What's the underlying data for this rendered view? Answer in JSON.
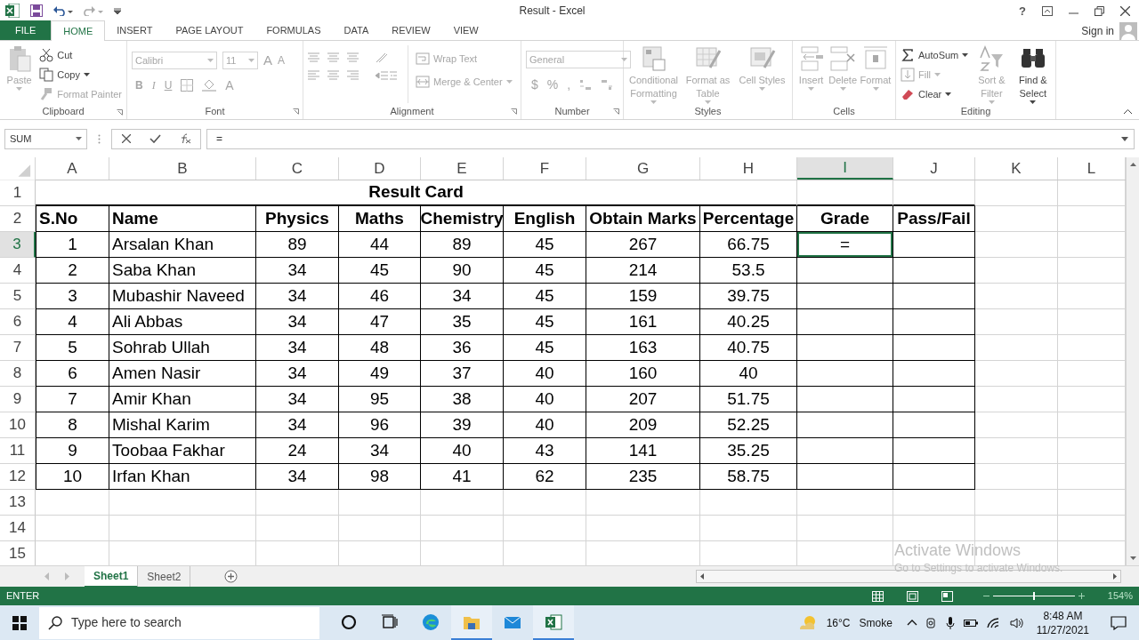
{
  "title_bar": {
    "title": "Result - Excel",
    "help": "?"
  },
  "ribbon": {
    "tabs": [
      {
        "label": "FILE",
        "kind": "file",
        "selected": false
      },
      {
        "label": "HOME",
        "kind": "tab",
        "selected": true
      },
      {
        "label": "INSERT",
        "kind": "tab",
        "selected": false
      },
      {
        "label": "PAGE LAYOUT",
        "kind": "tab",
        "selected": false
      },
      {
        "label": "FORMULAS",
        "kind": "tab",
        "selected": false
      },
      {
        "label": "DATA",
        "kind": "tab",
        "selected": false
      },
      {
        "label": "REVIEW",
        "kind": "tab",
        "selected": false
      },
      {
        "label": "VIEW",
        "kind": "tab",
        "selected": false
      }
    ],
    "sign_in": "Sign in",
    "groups": [
      {
        "label": "Clipboard",
        "kind": "clipboard",
        "large": {
          "label": "Paste",
          "disabled": true,
          "menu": true
        },
        "items": [
          {
            "label": "Cut",
            "disabled": false,
            "menu": false
          },
          {
            "label": "Copy",
            "disabled": false,
            "menu": true
          },
          {
            "label": "Format Painter",
            "disabled": true,
            "menu": false
          }
        ]
      },
      {
        "label": "Font",
        "kind": "font",
        "font_name": "Calibri",
        "font_size": "11",
        "glyphs": [
          "A",
          "A",
          "B",
          "I",
          "U",
          "A"
        ]
      },
      {
        "label": "Alignment",
        "kind": "alignment",
        "items": [
          {
            "label": "Wrap Text",
            "disabled": true,
            "menu": false
          },
          {
            "label": "Merge & Center",
            "disabled": true,
            "menu": true
          }
        ]
      },
      {
        "label": "Number",
        "kind": "number",
        "format": "General",
        "glyphs": [
          "$",
          "%",
          ","
        ]
      },
      {
        "label": "Styles",
        "kind": "large",
        "items": [
          {
            "label": "Conditional Formatting",
            "disabled": true,
            "menu": true
          },
          {
            "label": "Format as Table",
            "disabled": true,
            "menu": true
          },
          {
            "label": "Cell Styles",
            "disabled": true,
            "menu": true
          }
        ]
      },
      {
        "label": "Cells",
        "kind": "large",
        "items": [
          {
            "label": "Insert",
            "disabled": true,
            "menu": true
          },
          {
            "label": "Delete",
            "disabled": true,
            "menu": true
          },
          {
            "label": "Format",
            "disabled": true,
            "menu": true
          }
        ]
      },
      {
        "label": "Editing",
        "kind": "editing",
        "items": [
          {
            "label": "AutoSum",
            "disabled": false,
            "menu": true
          },
          {
            "label": "Fill",
            "disabled": true,
            "menu": true
          },
          {
            "label": "Clear",
            "disabled": false,
            "menu": true
          }
        ],
        "large": [
          {
            "label": "Sort & Filter",
            "disabled": true,
            "menu": true
          },
          {
            "label": "Find & Select",
            "disabled": false,
            "menu": true
          }
        ]
      }
    ]
  },
  "formula_bar": {
    "name_box": "SUM",
    "formula": "="
  },
  "sheet": {
    "columns": [
      {
        "label": "A",
        "selected": false
      },
      {
        "label": "B",
        "selected": false
      },
      {
        "label": "C",
        "selected": false
      },
      {
        "label": "D",
        "selected": false
      },
      {
        "label": "E",
        "selected": false
      },
      {
        "label": "F",
        "selected": false
      },
      {
        "label": "G",
        "selected": false
      },
      {
        "label": "H",
        "selected": false
      },
      {
        "label": "I",
        "selected": true
      },
      {
        "label": "J",
        "selected": false
      },
      {
        "label": "K",
        "selected": false
      },
      {
        "label": "L",
        "selected": false
      }
    ],
    "rows": [
      {
        "number": "1",
        "kind": "title",
        "selected": false,
        "cells": [
          "Result Card"
        ]
      },
      {
        "number": "2",
        "kind": "header",
        "selected": false,
        "cells": [
          "S.No",
          "Name",
          "Physics",
          "Maths",
          "Chemistry",
          "English",
          "Obtain Marks",
          "Percentage",
          "Grade",
          "Pass/Fail"
        ]
      },
      {
        "number": "3",
        "kind": "data",
        "selected": true,
        "cells": [
          "1",
          "Arsalan Khan",
          "89",
          "44",
          "89",
          "45",
          "267",
          "66.75",
          "="
        ]
      },
      {
        "number": "4",
        "kind": "data",
        "selected": false,
        "cells": [
          "2",
          "Saba Khan",
          "34",
          "45",
          "90",
          "45",
          "214",
          "53.5"
        ]
      },
      {
        "number": "5",
        "kind": "data",
        "selected": false,
        "cells": [
          "3",
          "Mubashir Naveed",
          "34",
          "46",
          "34",
          "45",
          "159",
          "39.75"
        ]
      },
      {
        "number": "6",
        "kind": "data",
        "selected": false,
        "cells": [
          "4",
          "Ali Abbas",
          "34",
          "47",
          "35",
          "45",
          "161",
          "40.25"
        ]
      },
      {
        "number": "7",
        "kind": "data",
        "selected": false,
        "cells": [
          "5",
          "Sohrab Ullah",
          "34",
          "48",
          "36",
          "45",
          "163",
          "40.75"
        ]
      },
      {
        "number": "8",
        "kind": "data",
        "selected": false,
        "cells": [
          "6",
          "Amen Nasir",
          "34",
          "49",
          "37",
          "40",
          "160",
          "40"
        ]
      },
      {
        "number": "9",
        "kind": "data",
        "selected": false,
        "cells": [
          "7",
          "Amir Khan",
          "34",
          "95",
          "38",
          "40",
          "207",
          "51.75"
        ]
      },
      {
        "number": "10",
        "kind": "data",
        "selected": false,
        "cells": [
          "8",
          "Mishal Karim",
          "34",
          "96",
          "39",
          "40",
          "209",
          "52.25"
        ]
      },
      {
        "number": "11",
        "kind": "data",
        "selected": false,
        "cells": [
          "9",
          "Toobaa Fakhar",
          "24",
          "34",
          "40",
          "43",
          "141",
          "35.25"
        ]
      },
      {
        "number": "12",
        "kind": "data",
        "selected": false,
        "cells": [
          "10",
          "Irfan Khan",
          "34",
          "98",
          "41",
          "62",
          "235",
          "58.75"
        ]
      },
      {
        "number": "13",
        "kind": "empty",
        "selected": false
      },
      {
        "number": "14",
        "kind": "empty",
        "selected": false
      },
      {
        "number": "15",
        "kind": "empty",
        "selected": false
      }
    ]
  },
  "sheet_tabs": [
    {
      "label": "Sheet1",
      "selected": true
    },
    {
      "label": "Sheet2",
      "selected": false
    }
  ],
  "status_bar": {
    "mode": "ENTER",
    "zoom": "154%",
    "zoom_slider": {
      "level": 0.5
    }
  },
  "activation_notice": {
    "title": "Activate Windows",
    "text": "Go to Settings to activate Windows."
  },
  "taskbar": {
    "search_placeholder": "Type here to search",
    "apps": [
      {
        "running": false
      },
      {
        "running": false
      },
      {
        "running": false
      },
      {
        "running": true
      },
      {
        "running": false
      },
      {
        "running": true
      }
    ],
    "temperature": "16°C",
    "condition": "Smoke",
    "time": "8:48 AM",
    "date": "11/27/2021"
  }
}
